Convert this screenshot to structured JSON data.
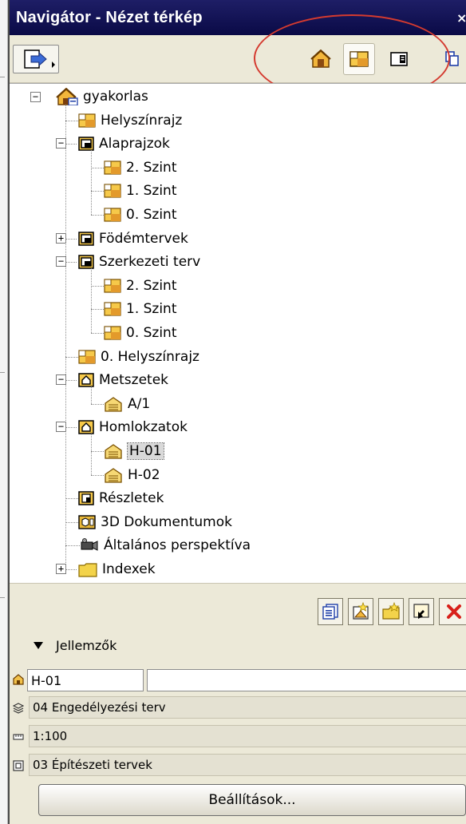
{
  "window": {
    "title": "Navigátor - Nézet térkép",
    "close_glyph": "×"
  },
  "toolbar": {
    "buttons": [
      {
        "icon": "publish-arrow-icon"
      },
      {
        "icon": "project-map-icon"
      },
      {
        "icon": "view-map-icon",
        "selected": true
      },
      {
        "icon": "layout-book-icon"
      },
      {
        "icon": "publisher-sets-icon"
      }
    ]
  },
  "tree": {
    "root": "gyakorlas",
    "items": [
      {
        "label": "Helyszínrajz"
      },
      {
        "label": "Alaprajzok",
        "expanded": true
      },
      {
        "label": "2. Szint"
      },
      {
        "label": "1. Szint"
      },
      {
        "label": "0. Szint"
      },
      {
        "label": "Födémtervek",
        "expanded": false
      },
      {
        "label": "Szerkezeti terv",
        "expanded": true
      },
      {
        "label": "2. Szint"
      },
      {
        "label": "1. Szint"
      },
      {
        "label": "0. Szint"
      },
      {
        "label": "0. Helyszínrajz"
      },
      {
        "label": "Metszetek",
        "expanded": true
      },
      {
        "label": "A/1"
      },
      {
        "label": "Homlokzatok",
        "expanded": true
      },
      {
        "label": "H-01",
        "selected": true
      },
      {
        "label": "H-02"
      },
      {
        "label": "Részletek"
      },
      {
        "label": "3D Dokumentumok"
      },
      {
        "label": "Általános perspektíva"
      },
      {
        "label": "Indexek",
        "expanded": false
      }
    ]
  },
  "properties": {
    "section_label": "Jellemzők",
    "id_value": "H-01",
    "name_value": "",
    "layer_combination": "04 Engedélyezési terv",
    "scale": "1:100",
    "model_view_option": "03 Építészeti tervek",
    "settings_button": "Beállítások..."
  },
  "colors": {
    "titlebar": "#0a0a46",
    "annotation_circle": "#d43a2f",
    "panel_bg": "#ece9d8"
  }
}
